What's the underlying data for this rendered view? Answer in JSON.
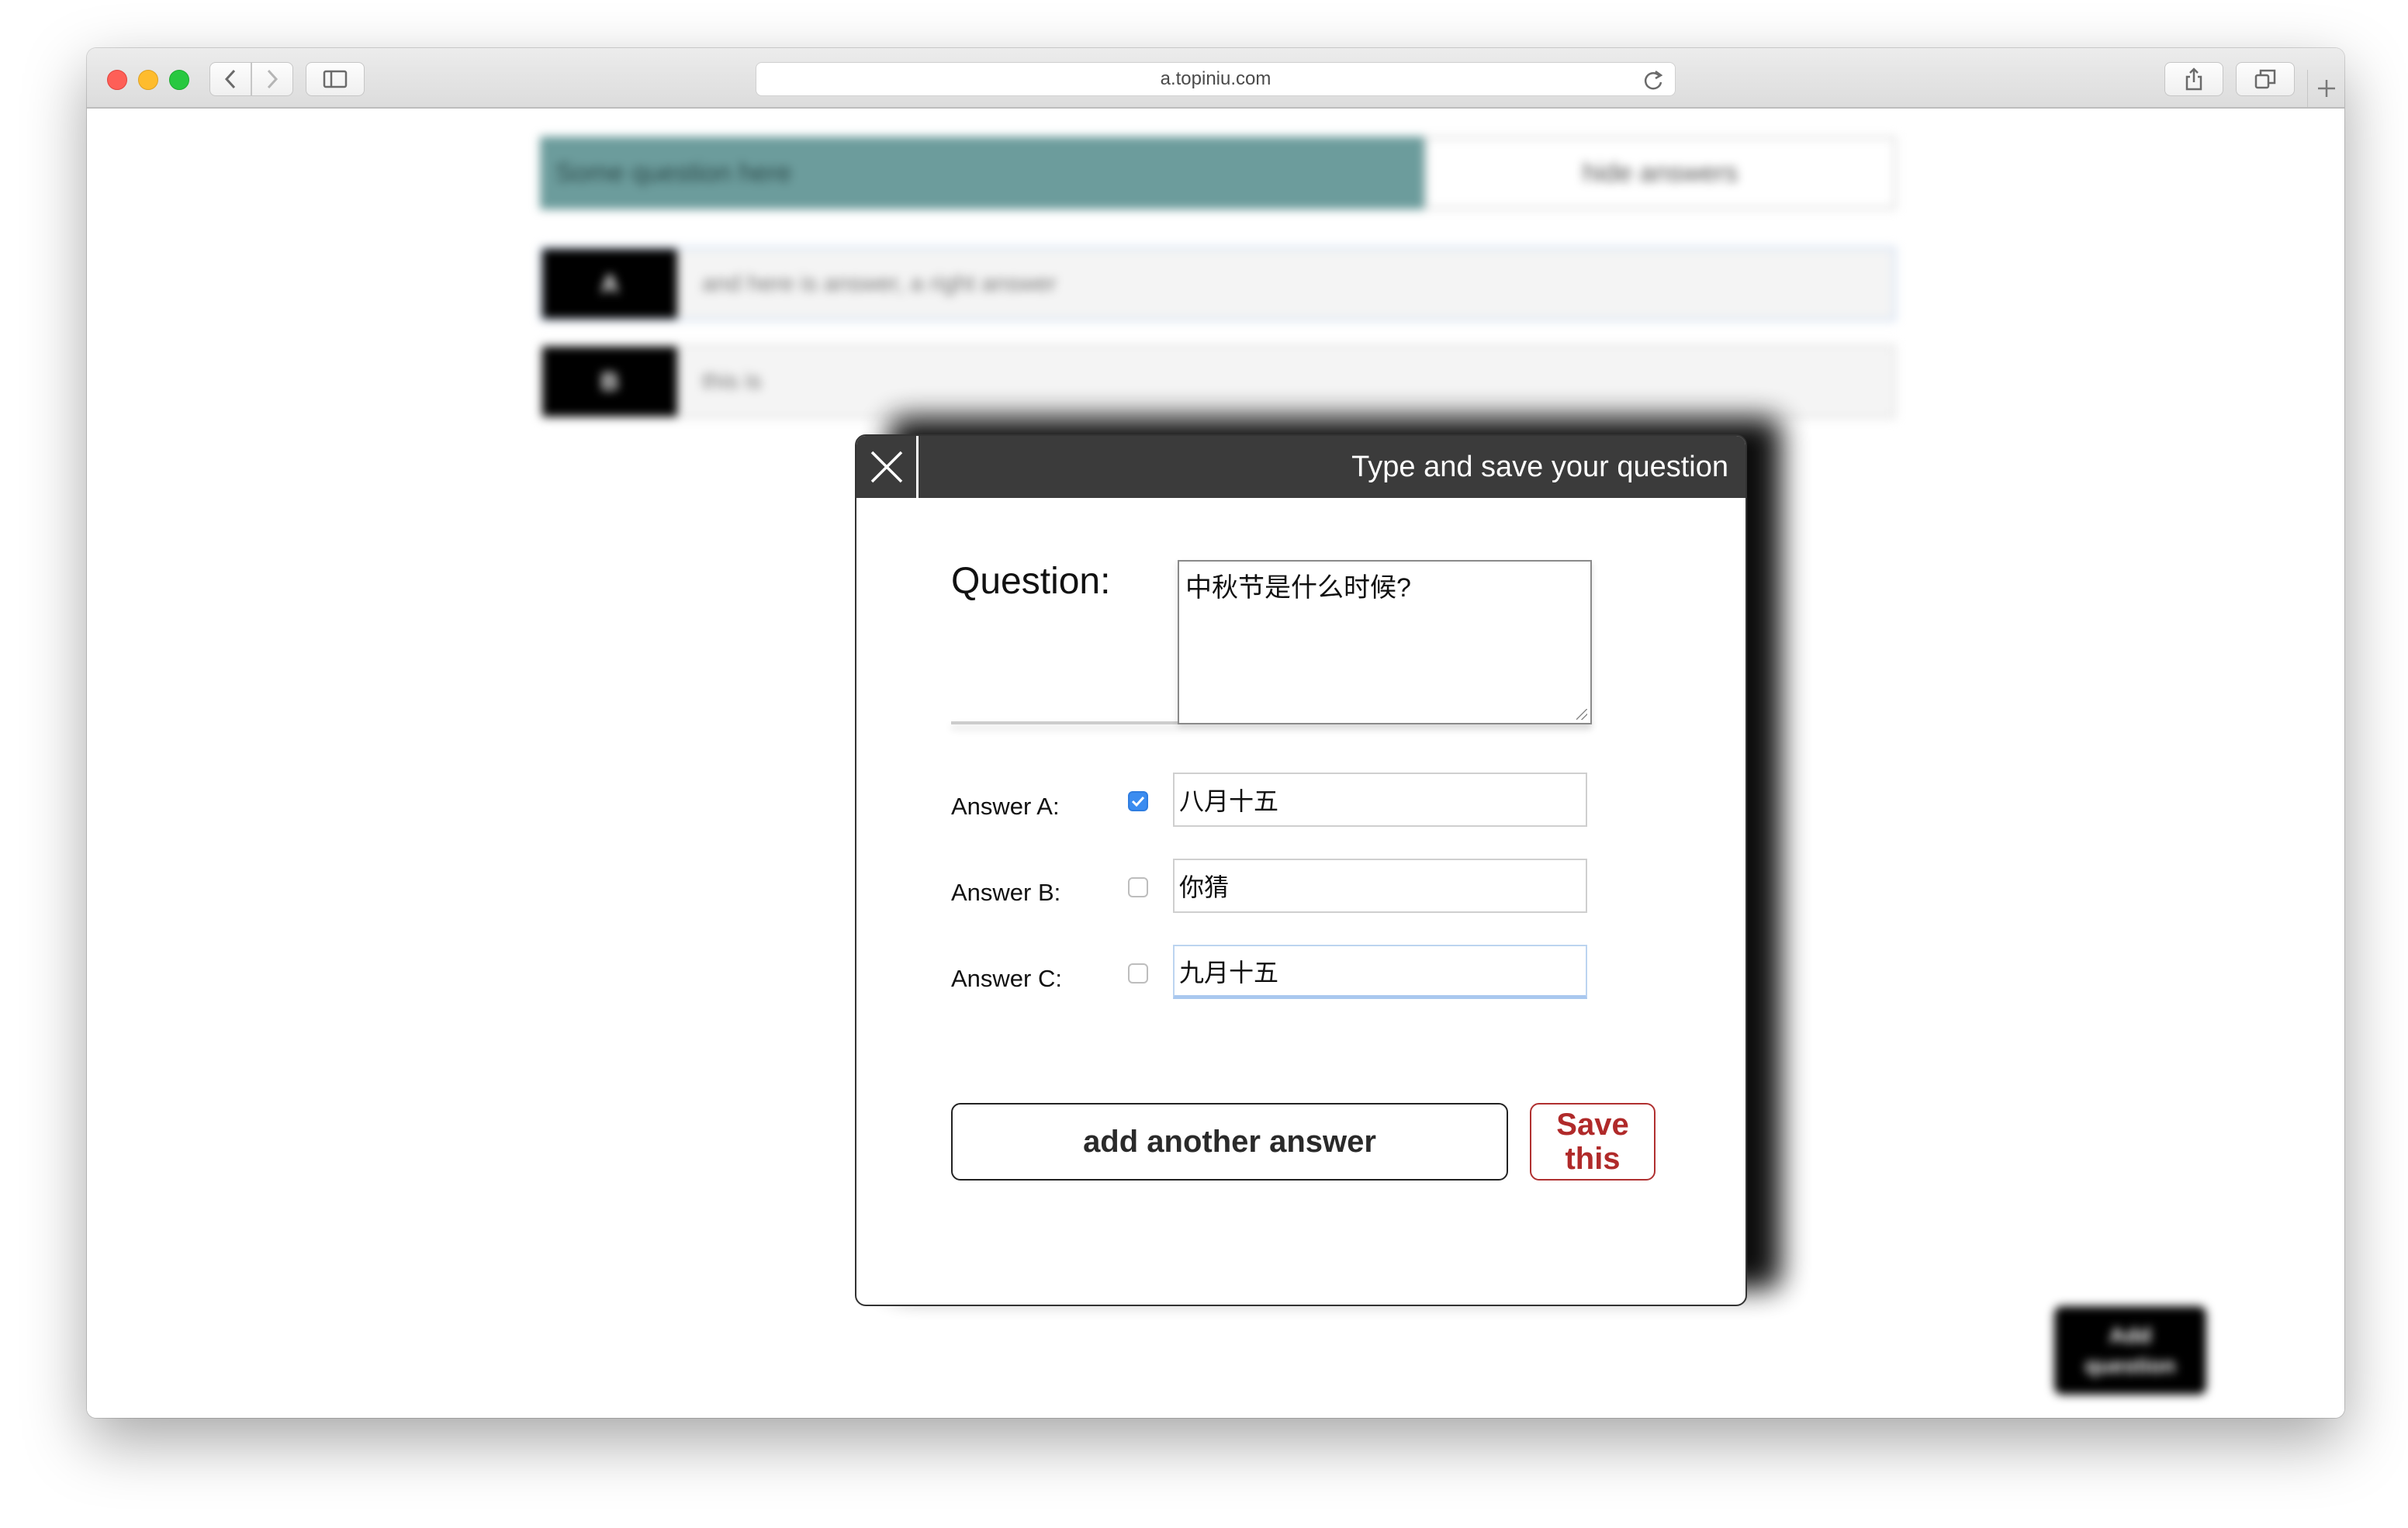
{
  "browser": {
    "url": "a.topiniu.com"
  },
  "background": {
    "question_text": "Some question here",
    "hide_answers_label": "hide answers",
    "answers": [
      {
        "letter": "A",
        "text": "and here is answer, a right answer"
      },
      {
        "letter": "B",
        "text": "this is"
      }
    ],
    "add_question_line1": "Add",
    "add_question_line2": "question"
  },
  "modal": {
    "title": "Type and save your question",
    "question_label": "Question:",
    "question_value": "中秋节是什么时候?",
    "answers": [
      {
        "label": "Answer A:",
        "value": "八月十五",
        "checked": true
      },
      {
        "label": "Answer B:",
        "value": "你猜",
        "checked": false
      },
      {
        "label": "Answer C:",
        "value": "九月十五",
        "checked": false
      }
    ],
    "add_answer_label": "add another answer",
    "save_line1": "Save",
    "save_line2": "this"
  },
  "colors": {
    "accent_teal": "#6c9c9c",
    "modal_header": "#3b3b3b",
    "save_red": "#b02a2a",
    "checkbox_blue": "#3b8cf0"
  }
}
